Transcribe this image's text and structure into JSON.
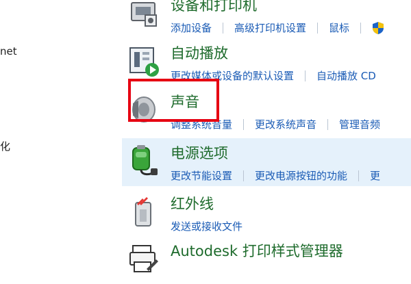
{
  "left_nav": {
    "fragment_1": "net",
    "fragment_2": "化"
  },
  "categories": [
    {
      "title": "设备和打印机",
      "icon": "printer-devices-icon",
      "links": [
        "添加设备",
        "高级打印机设置",
        "鼠标"
      ],
      "trailing_icon": "uac-shield-icon"
    },
    {
      "title": "自动播放",
      "icon": "autoplay-icon",
      "links": [
        "更改媒体或设备的默认设置",
        "自动播放 CD"
      ]
    },
    {
      "title": "声音",
      "icon": "speaker-icon",
      "links": [
        "调整系统音量",
        "更改系统声音",
        "管理音频"
      ]
    },
    {
      "title": "电源选项",
      "icon": "power-battery-icon",
      "links": [
        "更改节能设置",
        "更改电源按钮的功能",
        "更"
      ]
    },
    {
      "title": "红外线",
      "icon": "infrared-icon",
      "links": [
        "发送或接收文件"
      ]
    },
    {
      "title": "Autodesk 打印样式管理器",
      "icon": "autodesk-printer-icon",
      "links": []
    }
  ],
  "annotation": {
    "highlight_color": "#e60012"
  },
  "colors": {
    "title_green": "#1e6b2c",
    "link_blue": "#1a5bb5",
    "hover_bg": "#e5f1fb"
  }
}
